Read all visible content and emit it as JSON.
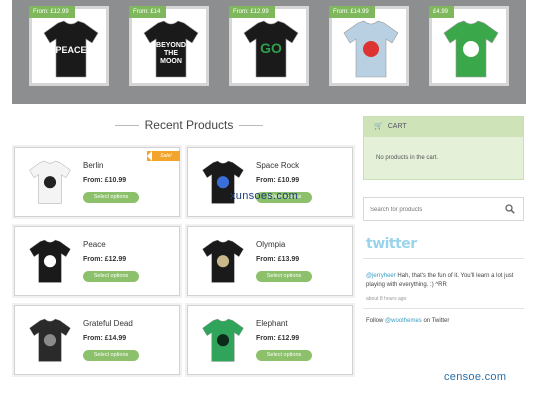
{
  "featured": [
    {
      "price": "From: £12.99",
      "shirt": "#1a1a1a",
      "graphic": "PEACE",
      "graphic_color": "#ffffff"
    },
    {
      "price": "From: £14",
      "shirt": "#1a1a1a",
      "graphic": "BEYOND THE MOON",
      "graphic_color": "#ffffff"
    },
    {
      "price": "From: £12.99",
      "shirt": "#1a1a1a",
      "graphic": "GO",
      "graphic_color": "#2fa04a"
    },
    {
      "price": "From: £14.99",
      "shirt": "#b9d0e2",
      "graphic": "",
      "graphic_color": "#d33"
    },
    {
      "price": "£4.99",
      "shirt": "#3aa84a",
      "graphic": "",
      "graphic_color": "#ffffff"
    }
  ],
  "section_title": "Recent Products",
  "products": [
    {
      "name": "Berlin",
      "price": "From: £10.99",
      "button": "Select options",
      "sale": "Sale!",
      "shirt": "#f4f4f4",
      "print": "#222222"
    },
    {
      "name": "Space Rock",
      "price": "From: £10.99",
      "button": "Select options",
      "sale": "",
      "shirt": "#1a1a1a",
      "print": "#3b6fd8"
    },
    {
      "name": "Peace",
      "price": "From: £12.99",
      "button": "Select options",
      "sale": "",
      "shirt": "#1a1a1a",
      "print": "#ffffff"
    },
    {
      "name": "Olympia",
      "price": "From: £13.99",
      "button": "Select options",
      "sale": "",
      "shirt": "#1a1a1a",
      "print": "#c9b98a"
    },
    {
      "name": "Grateful Dead",
      "price": "From: £14.99",
      "button": "Select options",
      "sale": "",
      "shirt": "#2a2a2a",
      "print": "#8a8a8a"
    },
    {
      "name": "Elephant",
      "price": "From: £12.99",
      "button": "Select options",
      "sale": "",
      "shirt": "#2fa45a",
      "print": "#0e2a1a"
    }
  ],
  "cart": {
    "title": "CART",
    "empty_text": "No products in the cart.",
    "icon": "cart-icon"
  },
  "search": {
    "placeholder": "Search for products",
    "icon": "search-icon"
  },
  "twitter": {
    "logo": "twitter",
    "tweet_handle": "@jerryheer",
    "tweet_text": " Hah, that's the fun of it. You'll learn a lot just playing with everything. :) ^RR",
    "tweet_time": "about 8 hours ago",
    "follow_prefix": "Follow ",
    "follow_handle": "@woothemes",
    "follow_suffix": " on Twitter"
  },
  "watermarks": {
    "center": "xunsoes.com",
    "corner": "censoe.com"
  },
  "colors": {
    "accent_green": "#8cc06a",
    "price_tag": "#7fb85c",
    "sale": "#f2a52c",
    "cart_bg": "#e4f0d8",
    "twitter_blue": "#3d9ec4"
  }
}
